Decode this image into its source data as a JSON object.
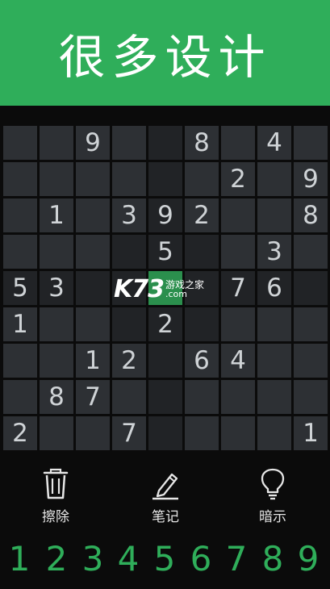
{
  "banner": {
    "title": "很多设计"
  },
  "theme": {
    "accent": "#2fae5a",
    "cell_bg": "#2d3034",
    "cell_bg_highlight": "#212326",
    "cell_bg_selected": "#2b8f4d",
    "digit_color": "#cfd3d6"
  },
  "board": {
    "rows": [
      [
        "",
        "",
        "9",
        "",
        "",
        "8",
        "",
        "4",
        ""
      ],
      [
        "",
        "",
        "",
        "",
        "",
        "",
        "2",
        "",
        "9"
      ],
      [
        "",
        "1",
        "",
        "3",
        "9",
        "2",
        "",
        "",
        "8"
      ],
      [
        "",
        "",
        "",
        "",
        "5",
        "",
        "",
        "3",
        ""
      ],
      [
        "5",
        "3",
        "",
        "",
        "",
        "",
        "7",
        "6",
        ""
      ],
      [
        "1",
        "",
        "",
        "",
        "2",
        "",
        "",
        "",
        ""
      ],
      [
        "",
        "",
        "1",
        "2",
        "",
        "6",
        "4",
        "",
        ""
      ],
      [
        "",
        "8",
        "7",
        "",
        "",
        "",
        "",
        "",
        ""
      ],
      [
        "2",
        "",
        "",
        "7",
        "",
        "",
        "",
        "",
        "1"
      ]
    ],
    "selected": {
      "row": 4,
      "col": 4
    }
  },
  "toolbar": {
    "erase_label": "擦除",
    "erase_icon": "trash-icon",
    "notes_label": "笔记",
    "notes_icon": "pencil-icon",
    "hint_label": "暗示",
    "hint_icon": "lightbulb-icon"
  },
  "numpad": [
    "1",
    "2",
    "3",
    "4",
    "5",
    "6",
    "7",
    "8",
    "9"
  ],
  "watermark": {
    "logo": "K73",
    "sub": "游戏之家",
    "domain": ".com"
  }
}
